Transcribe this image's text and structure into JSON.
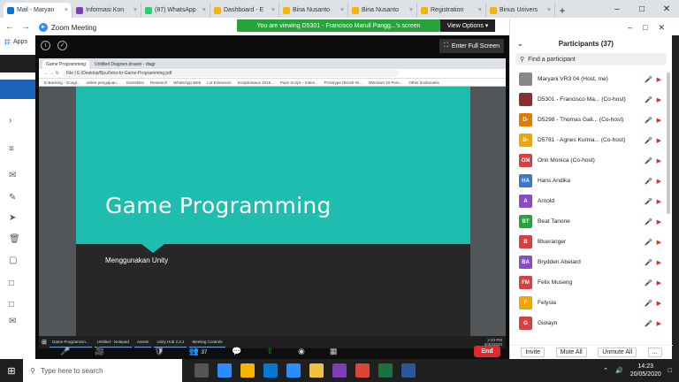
{
  "browser": {
    "tabs": [
      {
        "label": "Mail - Maryan",
        "color": "#0078d4",
        "active": true
      },
      {
        "label": "Informasi Kon",
        "color": "#7b3fb5",
        "active": false
      },
      {
        "label": "(87) WhatsApp",
        "color": "#25d366",
        "active": false
      },
      {
        "label": "Dashboard - E",
        "color": "#f4b400",
        "active": false
      },
      {
        "label": "Bina Nusanto",
        "color": "#f4b400",
        "active": false
      },
      {
        "label": "Bina Nusanto",
        "color": "#f4b400",
        "active": false
      },
      {
        "label": "Registration",
        "color": "#f4b400",
        "active": false
      },
      {
        "label": "Binus Univers",
        "color": "#f4b400",
        "active": false
      }
    ],
    "apps_label": "Apps"
  },
  "zoom": {
    "title": "Zoom Meeting",
    "banner": "You are viewing D5301 - Francisco Marull Pangg...'s screen",
    "view_options": "View Options",
    "fullscreen": "Enter Full Screen",
    "end_label": "End",
    "participant_count": "37"
  },
  "shared": {
    "tabs": [
      "Game Programming",
      "Untitled Diagram.drawio - diagr"
    ],
    "url": "File | E:/Desktop/Bpu/Intro-to-Game-Programming.pdf",
    "bookmarks": [
      "E-Banking - Googl...",
      "online pengajuan...",
      "GameDev",
      "Research",
      "WhatsApp Web",
      "Lot Extension",
      "Sculpturaaux 2018...",
      "Pixar Script – Interv...",
      "Prototype (Brush-W...",
      "Windows 10 Pers...",
      "Other bookmarks"
    ],
    "slide_title": "Game Programming",
    "slide_subtitle": "Menggunakan Unity",
    "taskbar_items": [
      "Game Programmin...",
      "Untitled - Notepad",
      "Assets",
      "Unity Hub 2.3.1",
      "Meeting Controls"
    ],
    "tray_time": "2:23 PM",
    "tray_date": "5/30/2020"
  },
  "participants": {
    "header": "Participants (37)",
    "search_placeholder": "Find a participant",
    "list": [
      {
        "initials": "",
        "name": "Maryani VR3 04 (Host, me)",
        "color": "#888888"
      },
      {
        "initials": "",
        "name": "D5301 - Francisco Ma... (Co-host)",
        "color": "#8b2e2e"
      },
      {
        "initials": "D-",
        "name": "D5298 - Thomas Gali... (Co-host)",
        "color": "#e07b00"
      },
      {
        "initials": "D-",
        "name": "D5781 - Agnes Kurnia... (Co-host)",
        "color": "#f0a500"
      },
      {
        "initials": "OM",
        "name": "Orin Monica (Co-host)",
        "color": "#d64040"
      },
      {
        "initials": "HA",
        "name": "Hans Andika",
        "color": "#3a78c8"
      },
      {
        "initials": "A",
        "name": "Arnold",
        "color": "#8a4cc4"
      },
      {
        "initials": "BT",
        "name": "Beat Tanone",
        "color": "#27a33c"
      },
      {
        "initials": "B",
        "name": "Blueranger",
        "color": "#d64040"
      },
      {
        "initials": "BA",
        "name": "Brydden Abelard",
        "color": "#8a4cc4"
      },
      {
        "initials": "FM",
        "name": "Felix Museng",
        "color": "#d64040"
      },
      {
        "initials": "F",
        "name": "Felysia",
        "color": "#f0a500"
      },
      {
        "initials": "G",
        "name": "Giolayn",
        "color": "#d64040"
      }
    ],
    "buttons": [
      "Invite",
      "Mute All",
      "Unmute All",
      "..."
    ]
  },
  "taskbar": {
    "search_placeholder": "Type here to search",
    "time": "14:23",
    "date": "20/05/2020"
  }
}
